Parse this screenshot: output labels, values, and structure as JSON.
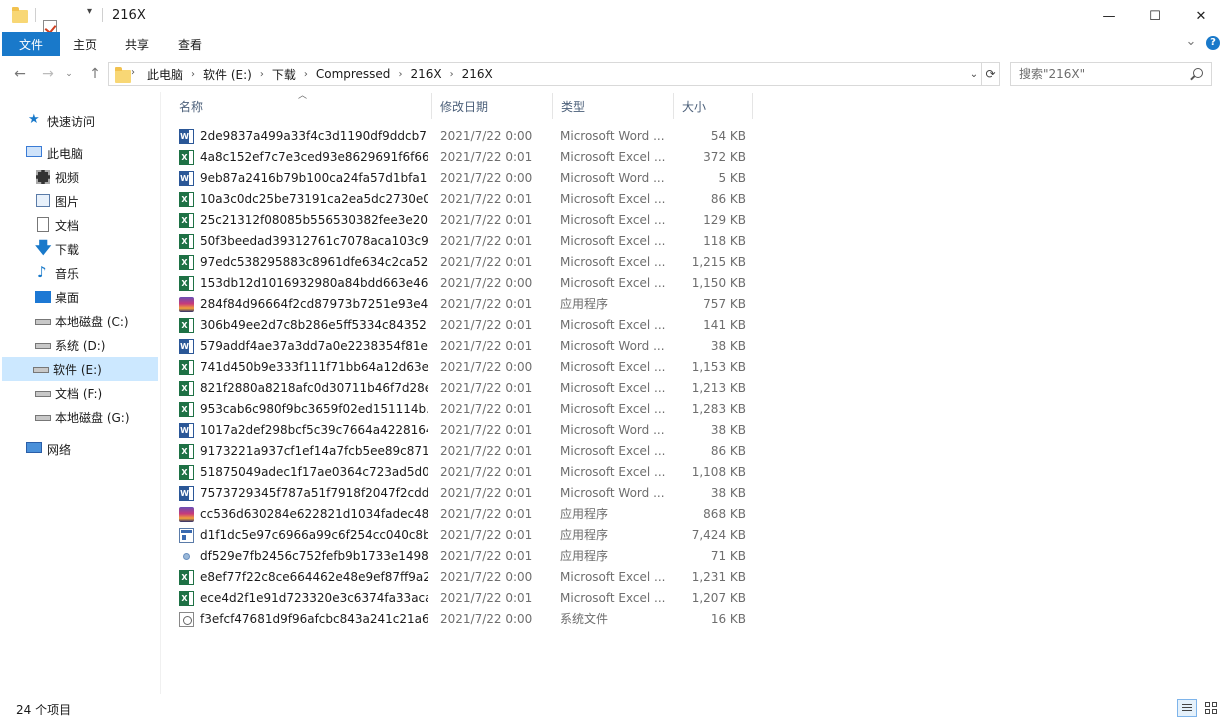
{
  "window": {
    "title": "216X",
    "minimize": "—",
    "maximize": "☐",
    "close": "✕"
  },
  "ribbon": {
    "tabs": [
      {
        "label": "文件"
      },
      {
        "label": "主页"
      },
      {
        "label": "共享"
      },
      {
        "label": "查看"
      }
    ],
    "collapse_glyph": "⌄",
    "help_glyph": "?"
  },
  "address": {
    "crumbs": [
      "此电脑",
      "软件 (E:)",
      "下载",
      "Compressed",
      "216X",
      "216X"
    ]
  },
  "search": {
    "placeholder": "搜索\"216X\""
  },
  "nav": {
    "quick_access": "快速访问",
    "this_pc": "此电脑",
    "videos": "视频",
    "pictures": "图片",
    "documents": "文档",
    "downloads": "下载",
    "music": "音乐",
    "desktop": "桌面",
    "drive_c": "本地磁盘 (C:)",
    "drive_d": "系统 (D:)",
    "drive_e": "软件 (E:)",
    "drive_f": "文档 (F:)",
    "drive_g": "本地磁盘 (G:)",
    "network": "网络"
  },
  "columns": {
    "name": "名称",
    "date": "修改日期",
    "type": "类型",
    "size": "大小"
  },
  "files": [
    {
      "name": "2de9837a499a33f4c3d1190df9ddcb7...",
      "date": "2021/7/22 0:00",
      "type": "Microsoft Word ...",
      "size": "54 KB",
      "icon": "word"
    },
    {
      "name": "4a8c152ef7c7e3ced93e8629691f6f66...",
      "date": "2021/7/22 0:01",
      "type": "Microsoft Excel ...",
      "size": "372 KB",
      "icon": "excel"
    },
    {
      "name": "9eb87a2416b79b100ca24fa57d1bfa1...",
      "date": "2021/7/22 0:00",
      "type": "Microsoft Word ...",
      "size": "5 KB",
      "icon": "word"
    },
    {
      "name": "10a3c0dc25be73191ca2ea5dc2730e0...",
      "date": "2021/7/22 0:01",
      "type": "Microsoft Excel ...",
      "size": "86 KB",
      "icon": "excel"
    },
    {
      "name": "25c21312f08085b556530382fee3e20...",
      "date": "2021/7/22 0:01",
      "type": "Microsoft Excel ...",
      "size": "129 KB",
      "icon": "excel"
    },
    {
      "name": "50f3beedad39312761c7078aca103c9...",
      "date": "2021/7/22 0:01",
      "type": "Microsoft Excel ...",
      "size": "118 KB",
      "icon": "excel"
    },
    {
      "name": "97edc538295883c8961dfe634c2ca52...",
      "date": "2021/7/22 0:01",
      "type": "Microsoft Excel ...",
      "size": "1,215 KB",
      "icon": "excel"
    },
    {
      "name": "153db12d1016932980a84bdd663e46...",
      "date": "2021/7/22 0:00",
      "type": "Microsoft Excel ...",
      "size": "1,150 KB",
      "icon": "excel"
    },
    {
      "name": "284f84d96664f2cd87973b7251e93e4...",
      "date": "2021/7/22 0:01",
      "type": "应用程序",
      "size": "757 KB",
      "icon": "app"
    },
    {
      "name": "306b49ee2d7c8b286e5ff5334c84352...",
      "date": "2021/7/22 0:01",
      "type": "Microsoft Excel ...",
      "size": "141 KB",
      "icon": "excel"
    },
    {
      "name": "579addf4ae37a3dd7a0e2238354f81e...",
      "date": "2021/7/22 0:01",
      "type": "Microsoft Word ...",
      "size": "38 KB",
      "icon": "word"
    },
    {
      "name": "741d450b9e333f111f71bb64a12d63e...",
      "date": "2021/7/22 0:00",
      "type": "Microsoft Excel ...",
      "size": "1,153 KB",
      "icon": "excel"
    },
    {
      "name": "821f2880a8218afc0d30711b46f7d28e...",
      "date": "2021/7/22 0:01",
      "type": "Microsoft Excel ...",
      "size": "1,213 KB",
      "icon": "excel"
    },
    {
      "name": "953cab6c980f9bc3659f02ed151114b...",
      "date": "2021/7/22 0:01",
      "type": "Microsoft Excel ...",
      "size": "1,283 KB",
      "icon": "excel"
    },
    {
      "name": "1017a2def298bcf5c39c7664a4228164...",
      "date": "2021/7/22 0:01",
      "type": "Microsoft Word ...",
      "size": "38 KB",
      "icon": "word"
    },
    {
      "name": "9173221a937cf1ef14a7fcb5ee89c871...",
      "date": "2021/7/22 0:01",
      "type": "Microsoft Excel ...",
      "size": "86 KB",
      "icon": "excel"
    },
    {
      "name": "51875049adec1f17ae0364c723ad5d0...",
      "date": "2021/7/22 0:01",
      "type": "Microsoft Excel ...",
      "size": "1,108 KB",
      "icon": "excel"
    },
    {
      "name": "7573729345f787a51f7918f2047f2cdd...",
      "date": "2021/7/22 0:01",
      "type": "Microsoft Word ...",
      "size": "38 KB",
      "icon": "word"
    },
    {
      "name": "cc536d630284e622821d1034fadec48...",
      "date": "2021/7/22 0:01",
      "type": "应用程序",
      "size": "868 KB",
      "icon": "app"
    },
    {
      "name": "d1f1dc5e97c6966a99c6f254cc040c8b...",
      "date": "2021/7/22 0:01",
      "type": "应用程序",
      "size": "7,424 KB",
      "icon": "app2"
    },
    {
      "name": "df529e7fb2456c752fefb9b1733e1498...",
      "date": "2021/7/22 0:01",
      "type": "应用程序",
      "size": "71 KB",
      "icon": "small"
    },
    {
      "name": "e8ef77f22c8ce664462e48e9ef87ff9a2...",
      "date": "2021/7/22 0:00",
      "type": "Microsoft Excel ...",
      "size": "1,231 KB",
      "icon": "excel"
    },
    {
      "name": "ece4d2f1e91d723320e3c6374fa33aca...",
      "date": "2021/7/22 0:01",
      "type": "Microsoft Excel ...",
      "size": "1,207 KB",
      "icon": "excel"
    },
    {
      "name": "f3efcf47681d9f96afcbc843a241c21a6...",
      "date": "2021/7/22 0:00",
      "type": "系统文件",
      "size": "16 KB",
      "icon": "sys"
    }
  ],
  "status": {
    "count": "24 个项目"
  }
}
